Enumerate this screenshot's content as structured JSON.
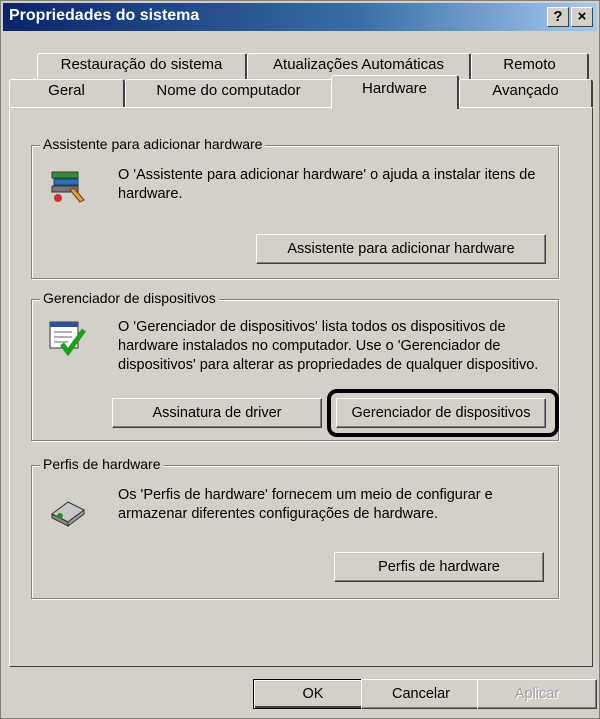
{
  "window": {
    "title": "Propriedades do sistema",
    "help_label": "?",
    "close_label": "×"
  },
  "tabs_row1": [
    {
      "label": "Restauração do sistema"
    },
    {
      "label": "Atualizações Automáticas"
    },
    {
      "label": "Remoto"
    }
  ],
  "tabs_row2": [
    {
      "label": "Geral"
    },
    {
      "label": "Nome do computador"
    },
    {
      "label": "Hardware"
    },
    {
      "label": "Avançado"
    }
  ],
  "active_tab": "Hardware",
  "groups": {
    "add_hardware": {
      "title": "Assistente para adicionar hardware",
      "description": "O 'Assistente para adicionar hardware' o ajuda a instalar itens de hardware.",
      "button": "Assistente para adicionar hardware"
    },
    "device_manager": {
      "title": "Gerenciador de dispositivos",
      "description": "O 'Gerenciador de dispositivos' lista todos os dispositivos de hardware instalados no computador. Use o 'Gerenciador de dispositivos' para alterar as propriedades de qualquer dispositivo.",
      "button_driver": "Assinatura de driver",
      "button_manager": "Gerenciador de dispositivos"
    },
    "hardware_profiles": {
      "title": "Perfis de hardware",
      "description": "Os 'Perfis de hardware' fornecem um meio de configurar e armazenar diferentes configurações de hardware.",
      "button": "Perfis de hardware"
    }
  },
  "footer": {
    "ok": "OK",
    "cancel": "Cancelar",
    "apply": "Aplicar"
  },
  "colors": {
    "titlebar_start": "#0a246a",
    "titlebar_end": "#a6caf0",
    "face": "#d4d0c8"
  }
}
